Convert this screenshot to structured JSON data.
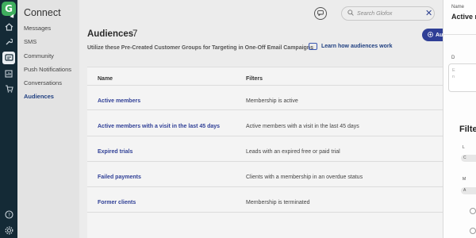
{
  "brand": {
    "logo_letter": "G",
    "accent": "#3fae5e"
  },
  "rail": {
    "items": [
      {
        "icon": "home-icon"
      },
      {
        "icon": "wrench-icon"
      },
      {
        "icon": "connect-chat-icon",
        "active": true
      },
      {
        "icon": "reports-icon"
      },
      {
        "icon": "cart-icon"
      },
      {
        "icon": "help-icon"
      },
      {
        "icon": "settings-icon"
      }
    ]
  },
  "leftnav": {
    "title": "Connect",
    "items": [
      {
        "label": "Messages"
      },
      {
        "label": "SMS"
      },
      {
        "label": "Community"
      },
      {
        "label": "Push Notifications"
      },
      {
        "label": "Conversations"
      },
      {
        "label": "Audiences",
        "active": true
      }
    ]
  },
  "header": {
    "search_placeholder": "Search Glofox",
    "close_icon": "close-icon"
  },
  "page": {
    "title": "Audiences",
    "count": "7",
    "add_label": "Au",
    "subtitle": "Utilize these Pre-Created Customer Groups for Targeting in One-Off Email Campaigns",
    "learn_link": "Learn how audiences work"
  },
  "table": {
    "columns": [
      "Name",
      "Filters"
    ],
    "rows": [
      {
        "name": "Active members",
        "filter": "Membership is active"
      },
      {
        "name": "Active members with a visit in the last 45 days",
        "filter": "Active members with a visit in the last 45 days"
      },
      {
        "name": "Expired trials",
        "filter": "Leads with an expired free or paid trial"
      },
      {
        "name": "Failed payments",
        "filter": "Clients with a membership in an overdue status"
      },
      {
        "name": "Former clients",
        "filter": "Membership is terminated"
      }
    ]
  },
  "drawer": {
    "name_label": "Name",
    "name_value": "Active m",
    "desc_label": "D",
    "desc_placeholder": "E",
    "desc_placeholder2": "n",
    "filters_title": "Filte",
    "f1_label": "L",
    "f1_value": "C",
    "f2_label": "M",
    "f2_value": "A"
  }
}
